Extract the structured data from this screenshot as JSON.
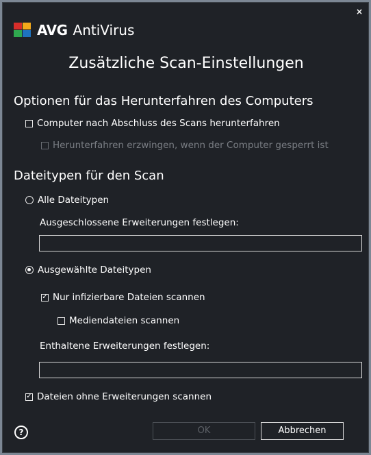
{
  "app": {
    "brand": "AVG",
    "product": "AntiVirus"
  },
  "dialog": {
    "title": "Zusätzliche Scan-Einstellungen"
  },
  "shutdown": {
    "title": "Optionen für das Herunterfahren des Computers",
    "shutdown_after_scan": "Computer nach Abschluss des Scans herunterfahren",
    "force_shutdown": "Herunterfahren erzwingen, wenn der Computer gesperrt ist"
  },
  "filetypes": {
    "title": "Dateitypen für den Scan",
    "all_types": "Alle Dateitypen",
    "excluded_label": "Ausgeschlossene Erweiterungen festlegen:",
    "excluded_value": "",
    "selected_types": "Ausgewählte Dateitypen",
    "infectable_only": "Nur infizierbare Dateien scannen",
    "media_files": "Mediendateien scannen",
    "included_label": "Enthaltene Erweiterungen festlegen:",
    "included_value": "",
    "no_extension": "Dateien ohne Erweiterungen scannen"
  },
  "footer": {
    "ok": "OK",
    "cancel": "Abbrechen"
  }
}
